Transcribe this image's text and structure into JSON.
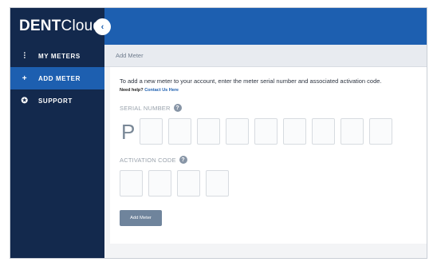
{
  "brand": {
    "bold": "DENT",
    "light": "Cloud"
  },
  "sidebar": {
    "items": [
      {
        "icon": "meters-sliders-icon",
        "glyph": "⫶",
        "label": "MY METERS",
        "active": false
      },
      {
        "icon": "plus-icon",
        "glyph": "+",
        "label": "ADD METER",
        "active": true
      },
      {
        "icon": "support-lifebuoy-icon",
        "glyph": "✪",
        "label": "SUPPORT",
        "active": false
      }
    ]
  },
  "topbar": {
    "collapse_glyph": "‹"
  },
  "breadcrumb": {
    "title": "Add Meter"
  },
  "form": {
    "intro": "To add a new meter to your account, enter the meter serial number and associated activation code.",
    "help_prefix": "Need help?",
    "help_link": "Contact Us Here",
    "serial_label": "SERIAL NUMBER",
    "serial_prefix": "P",
    "serial_box_count": 9,
    "activation_label": "ACTIVATION CODE",
    "activation_box_count": 4,
    "help_glyph": "?",
    "submit_label": "Add Meter"
  },
  "colors": {
    "sidebar_bg": "#13294d",
    "accent": "#1d5fb0",
    "button": "#6f849c"
  }
}
